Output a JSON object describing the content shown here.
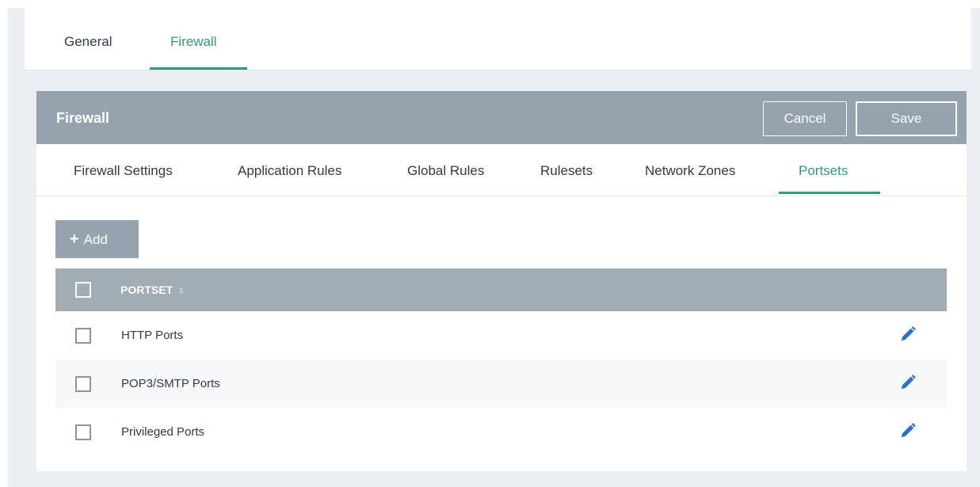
{
  "top_tabs": [
    {
      "label": "General",
      "active": false
    },
    {
      "label": "Firewall",
      "active": true
    }
  ],
  "panel": {
    "title": "Firewall",
    "cancel_label": "Cancel",
    "save_label": "Save"
  },
  "sub_tabs": [
    {
      "label": "Firewall Settings",
      "active": false
    },
    {
      "label": "Application Rules",
      "active": false
    },
    {
      "label": "Global Rules",
      "active": false
    },
    {
      "label": "Rulesets",
      "active": false
    },
    {
      "label": "Network Zones",
      "active": false
    },
    {
      "label": "Portsets",
      "active": true
    }
  ],
  "toolbar": {
    "add_label": "Add",
    "add_icon": "plus-icon"
  },
  "table": {
    "column_header": "PORTSET",
    "sort_icon": "sort-icon",
    "rows": [
      {
        "name": "HTTP Ports",
        "checked": false,
        "action_icon": "pencil-icon"
      },
      {
        "name": "POP3/SMTP Ports",
        "checked": false,
        "action_icon": "pencil-icon"
      },
      {
        "name": "Privileged Ports",
        "checked": false,
        "action_icon": "pencil-icon"
      }
    ]
  },
  "colors": {
    "accent": "#2e9c79",
    "header_bg": "#94a3ae",
    "table_header_bg": "#a1acb5",
    "edit_icon": "#2f6fd1"
  }
}
